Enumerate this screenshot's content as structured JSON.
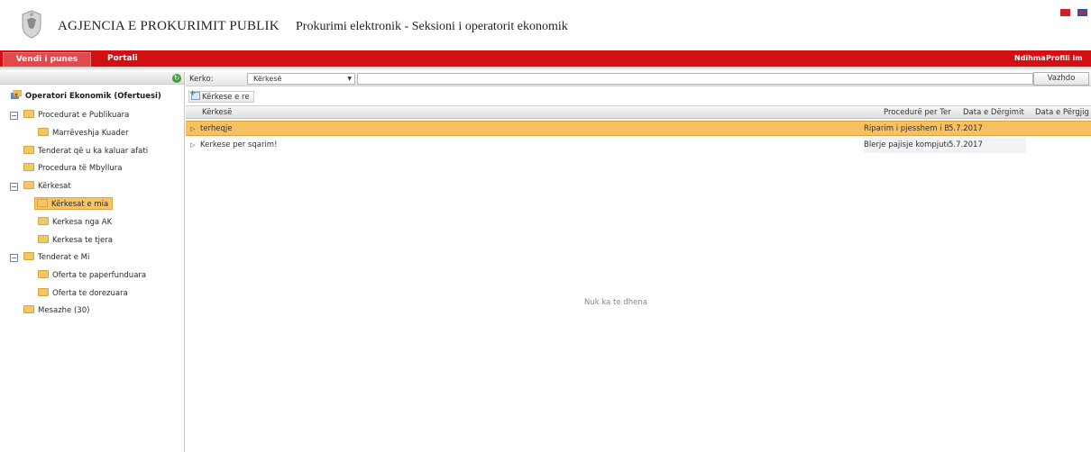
{
  "header": {
    "agency_name": "AGJENCIA E PROKURIMIT PUBLIK",
    "subtitle": "Prokurimi elektronik - Seksioni i operatorit ekonomik",
    "flags": [
      "flag-albania",
      "flag-english"
    ]
  },
  "nav": {
    "tabs": [
      {
        "label": "Vendi i punes",
        "active": true
      },
      {
        "label": "Portali",
        "active": false
      }
    ],
    "right_links": [
      "Ndihma",
      "Profili im"
    ]
  },
  "sidebar": {
    "refresh_icon": "refresh-icon",
    "items": [
      {
        "label": "Operatori Ekonomik (Ofertuesi)",
        "type": "root",
        "icon": "operator-icon"
      },
      {
        "label": "Procedurat e Publikuara",
        "type": "folder",
        "expandable": true,
        "expanded": true
      },
      {
        "label": "Marrëveshja Kuader",
        "type": "folder"
      },
      {
        "label": "Tenderat që u ka kaluar afati",
        "type": "folder"
      },
      {
        "label": "Procedura të Mbyllura",
        "type": "folder"
      },
      {
        "label": "Kërkesat",
        "type": "folder",
        "expandable": true,
        "expanded": true
      },
      {
        "label": "Kërkesat e mia",
        "type": "folder",
        "selected": true
      },
      {
        "label": "Kerkesa nga AK",
        "type": "folder"
      },
      {
        "label": "Kerkesa te tjera",
        "type": "folder"
      },
      {
        "label": "Tenderat e Mi",
        "type": "folder",
        "expandable": true,
        "expanded": true
      },
      {
        "label": "Oferta te paperfunduara",
        "type": "folder"
      },
      {
        "label": "Oferta te dorezuara",
        "type": "folder"
      },
      {
        "label": "Mesazhe (30)",
        "type": "folder"
      }
    ]
  },
  "search": {
    "label": "Kerko:",
    "selected_option": "Kërkesë",
    "input_value": "",
    "go_label": "Vazhdo"
  },
  "actions": {
    "new_request_label": "Kërkese e re"
  },
  "grid": {
    "columns": [
      "Kërkesë",
      "Procedurë per Ter",
      "Data e Dërgimit",
      "Data e Përgjigjes"
    ],
    "rows": [
      {
        "request": "terheqje",
        "procedure": "Riparim i pjesshem i B",
        "date_sent": "5.7.2017",
        "date_reply": "",
        "selected": true
      },
      {
        "request": "Kerkese per sqarim!",
        "procedure": "Blerje pajisje kompjute",
        "date_sent": "5.7.2017",
        "date_reply": "",
        "selected": false
      }
    ],
    "empty_text": "Nuk ka te dhena"
  },
  "colors": {
    "nav_red": "#d40f14",
    "selection_orange": "#f7c162",
    "folder_yellow": "#f2c867"
  }
}
